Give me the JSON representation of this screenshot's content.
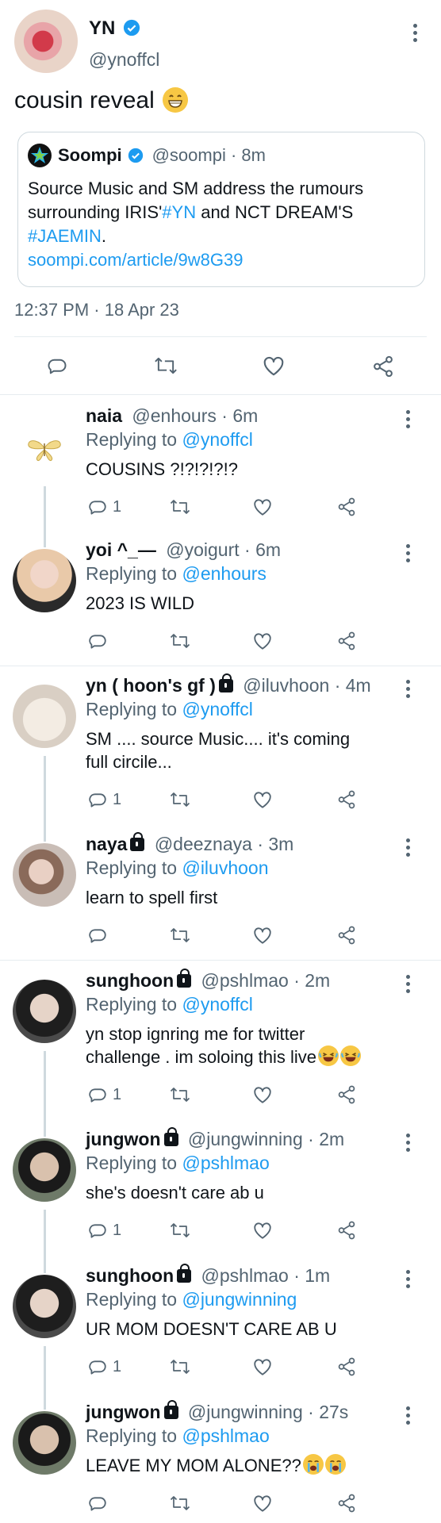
{
  "main_tweet": {
    "name": "YN",
    "handle": "@ynoffcl",
    "text": "cousin reveal",
    "timestamp": "12:37 PM · 18 Apr 23",
    "quote": {
      "name": "Soompi",
      "handle": "@soompi · 8m",
      "line1": "Source Music and SM address the rumours",
      "line2a": "surrounding IRIS'",
      "line2b": "#YN",
      "line2c": " and NCT DREAM'S",
      "line3a": "#JAEMIN",
      "line3b": ".",
      "link": "soompi.com/article/9w8G39"
    }
  },
  "replies": [
    {
      "name": "naia",
      "handle": "@enhours · 6m",
      "replying_prefix": "Replying to ",
      "replying_to": "@ynoffcl",
      "text": [
        "COUSINS ?!?!?!?!?"
      ],
      "reply_count": "1"
    },
    {
      "name": "yoi ^_—",
      "handle": "@yoigurt · 6m",
      "replying_prefix": "Replying to ",
      "replying_to": "@enhours",
      "text": [
        "2023 IS WILD"
      ],
      "reply_count": ""
    },
    {
      "name": "yn ( hoon's gf )",
      "handle": "@iluvhoon · 4m",
      "replying_prefix": "Replying to ",
      "replying_to": "@ynoffcl",
      "text": [
        "SM .... source Music.... it's coming",
        "full circile..."
      ],
      "reply_count": "1"
    },
    {
      "name": "naya",
      "handle": "@deeznaya · 3m",
      "replying_prefix": "Replying to ",
      "replying_to": "@iluvhoon",
      "text": [
        "learn to spell first"
      ],
      "reply_count": ""
    },
    {
      "name": "sunghoon",
      "handle": "@pshlmao · 2m",
      "replying_prefix": "Replying to ",
      "replying_to": "@ynoffcl",
      "text": [
        "yn stop ignring me for twitter",
        "challenge . im soloing this live"
      ],
      "reply_count": "1"
    },
    {
      "name": "jungwon",
      "handle": "@jungwinning · 2m",
      "replying_prefix": "Replying to ",
      "replying_to": "@pshlmao",
      "text": [
        "she's doesn't care ab u"
      ],
      "reply_count": "1"
    },
    {
      "name": "sunghoon",
      "handle": "@pshlmao · 1m",
      "replying_prefix": "Replying to ",
      "replying_to": "@jungwinning",
      "text": [
        "UR MOM DOESN'T CARE AB U"
      ],
      "reply_count": "1"
    },
    {
      "name": "jungwon",
      "handle": "@jungwinning · 27s",
      "replying_prefix": "Replying to ",
      "replying_to": "@pshlmao",
      "text": [
        "LEAVE MY MOM ALONE??"
      ],
      "reply_count": ""
    }
  ],
  "colors": {
    "accent": "#1d9bf0",
    "muted": "#536471",
    "text": "#0f1419",
    "divider": "#e6ecf0"
  },
  "icons": [
    "reply-icon",
    "retweet-icon",
    "like-icon",
    "share-icon",
    "more-icon",
    "verified-icon",
    "lock-icon"
  ]
}
